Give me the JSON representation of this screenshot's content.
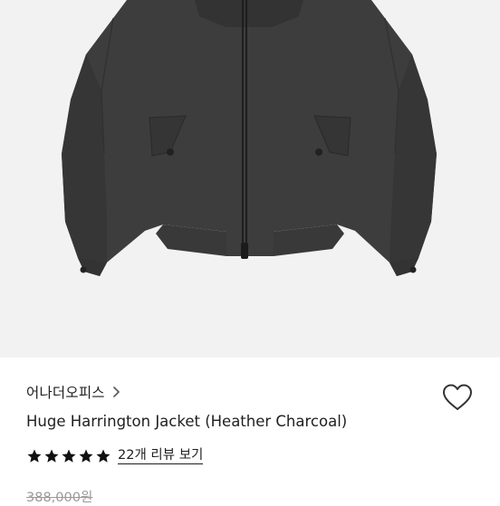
{
  "product": {
    "image_alt": "Huge Harrington Jacket (Heather Charcoal)",
    "brand": "어나더오피스",
    "brand_chevron_icon": "chevron-right-icon",
    "wishlist_icon": "heart-outline-icon",
    "name": "Huge Harrington Jacket (Heather Charcoal)",
    "rating": 5,
    "rating_max": 5,
    "reviews_label": "22개 리뷰 보기",
    "original_price": "388,000원"
  },
  "colors": {
    "image_bg": "#f2f2f2",
    "jacket": "#3d3d3d",
    "star": "#111111",
    "strike_price": "#9a9a9a"
  }
}
